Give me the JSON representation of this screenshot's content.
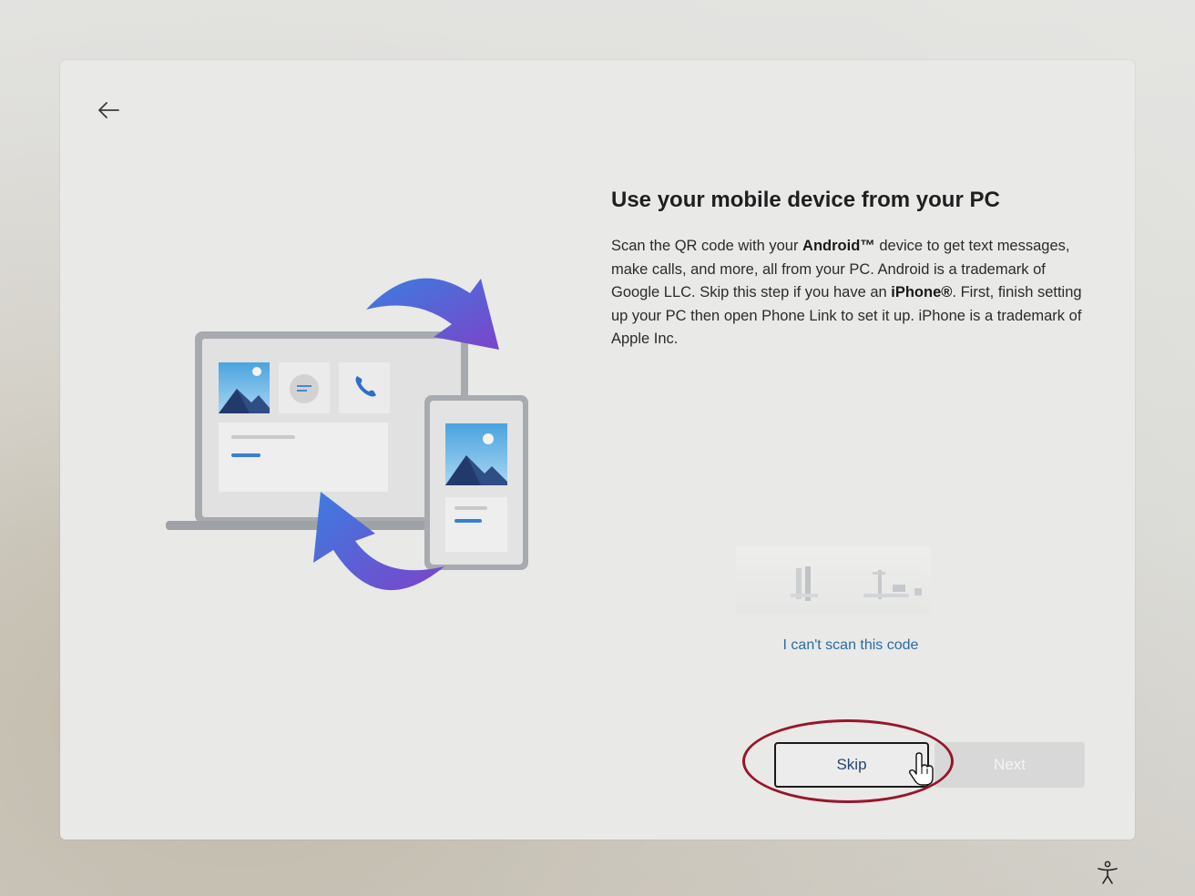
{
  "page": {
    "title": "Use your mobile device from your PC",
    "description": {
      "p1": "Scan the QR code with your ",
      "android": "Android™",
      "p2": " device to get text messages, make calls, and more, all from your PC. Android is a trademark of Google LLC. Skip this step if you have an ",
      "iphone": "iPhone®",
      "p3": ". First, finish setting up your PC then open Phone Link to set it up. iPhone is a trademark of Apple Inc."
    },
    "cant_scan_link": "I can't scan this code"
  },
  "buttons": {
    "skip_label": "Skip",
    "next_label": "Next"
  },
  "icons": {
    "back": "back-arrow-icon",
    "accessibility": "accessibility-icon",
    "cursor": "hand-pointer-cursor"
  },
  "colors": {
    "link": "#2b6aa3",
    "highlight_ring": "#98162a",
    "arrow_gradient_start": "#3c7de0",
    "arrow_gradient_end": "#7b44c9"
  }
}
